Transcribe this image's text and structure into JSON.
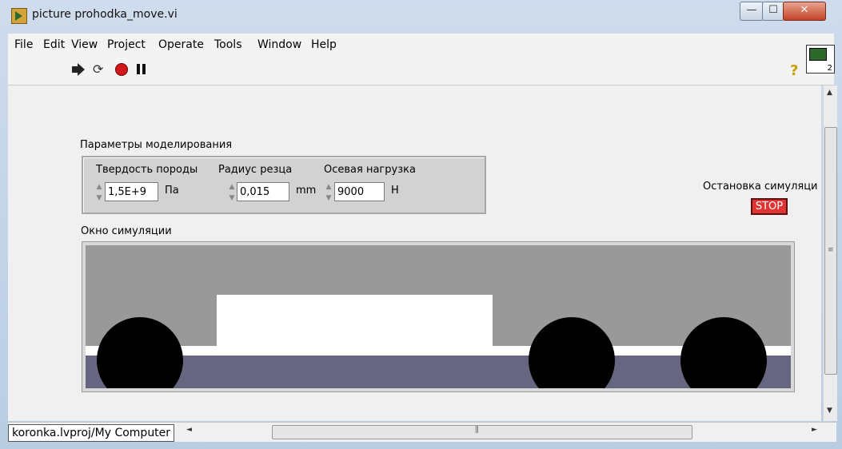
{
  "window": {
    "title": "picture prohodka_move.vi",
    "minimize_glyph": "—",
    "maximize_glyph": "☐",
    "close_glyph": "✕"
  },
  "menu": {
    "items": [
      "File",
      "Edit",
      "View",
      "Project",
      "Operate",
      "Tools",
      "Window",
      "Help"
    ]
  },
  "toolbar": {
    "icons": [
      "run-arrow-icon",
      "run-continuously-icon",
      "abort-icon",
      "pause-icon"
    ],
    "run_continuously_glyph": "⟳",
    "help_glyph": "?"
  },
  "params": {
    "group_label": "Параметры моделирования",
    "hardness": {
      "label": "Твердость породы",
      "value": "1,5E+9",
      "unit": "Па"
    },
    "radius": {
      "label": "Радиус резца",
      "value": "0,015",
      "unit": "mm"
    },
    "load": {
      "label": "Осевая нагрузка",
      "value": "9000",
      "unit": "H"
    }
  },
  "stop": {
    "label": "Остановка симуляци",
    "button": "STOP"
  },
  "simulation": {
    "label": "Окно симуляции",
    "colors": {
      "body": "#999999",
      "ground": "#666680",
      "wheel": "#000000",
      "background": "#ffffff"
    }
  },
  "status": {
    "project_path": "koronka.lvproj/My Computer"
  },
  "scrollbars": {
    "up": "▲",
    "down": "▼",
    "left": "◄",
    "right": "►",
    "grip_v": "≡",
    "grip_h": "⫼"
  }
}
